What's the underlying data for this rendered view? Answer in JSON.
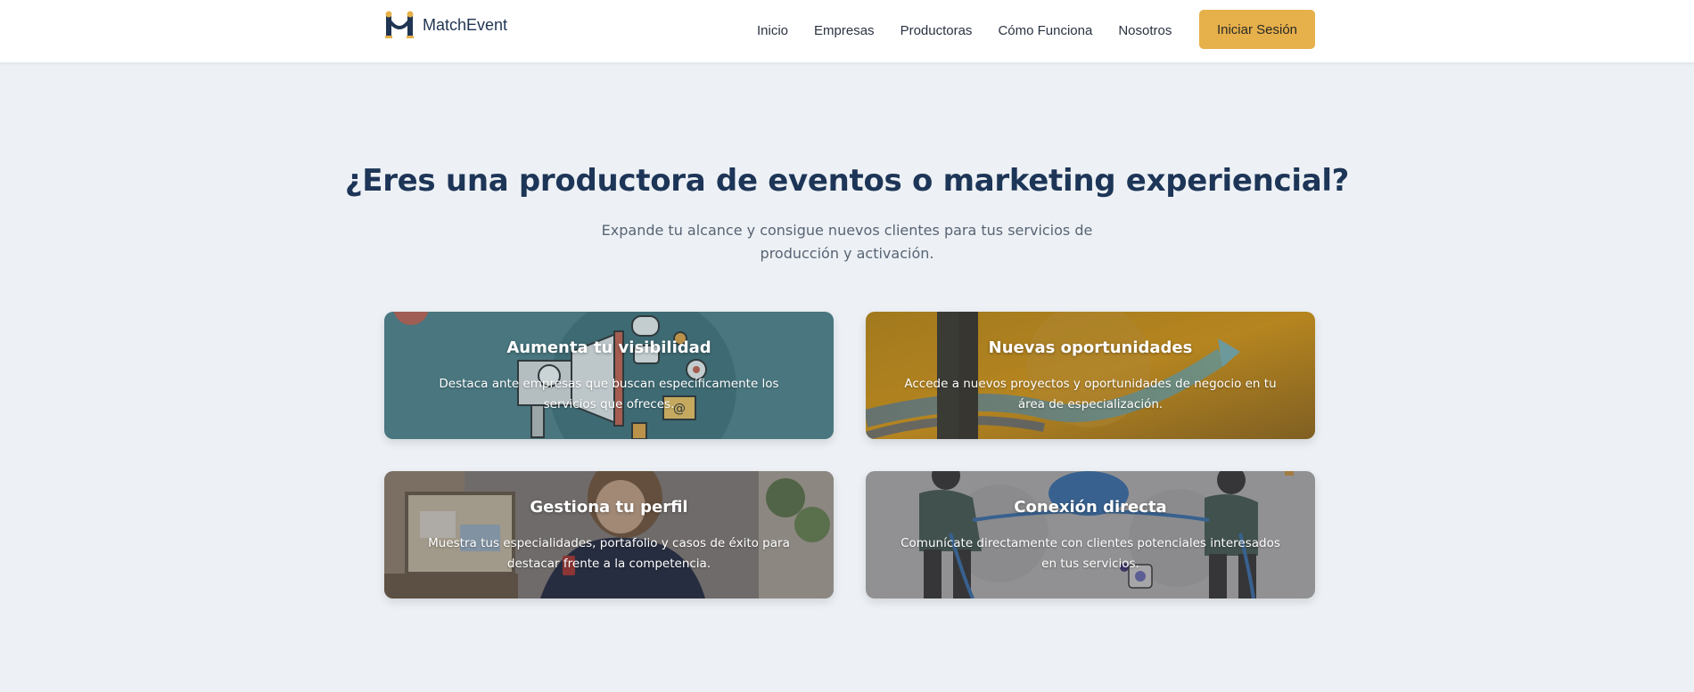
{
  "header": {
    "logo_text": "MatchEvent",
    "logo_icon": "match-event-logo-icon",
    "nav": [
      "Inicio",
      "Empresas",
      "Productoras",
      "Cómo Funciona",
      "Nosotros"
    ],
    "login_label": "Iniciar Sesión"
  },
  "hero": {
    "title": "¿Eres una productora de eventos o marketing experiencial?",
    "subtitle": "Expande tu alcance y consigue nuevos clientes para tus servicios de producción y activación."
  },
  "cards": [
    {
      "title": "Aumenta tu visibilidad",
      "description": "Destaca ante empresas que buscan específicamente los servicios que ofreces.",
      "image": "megaphone-illustration"
    },
    {
      "title": "Nuevas oportunidades",
      "description": "Accede a nuevos proyectos y oportunidades de negocio en tu área de especialización.",
      "image": "businessman-growth-arrow-photo"
    },
    {
      "title": "Gestiona tu perfil",
      "description": "Muestra tus especialidades, portafolio y casos de éxito para destacar frente a la competencia.",
      "image": "woman-with-phone-photo"
    },
    {
      "title": "Conexión directa",
      "description": "Comunícate directamente con clientes potenciales interesados en tus servicios.",
      "image": "tug-of-war-illustration"
    }
  ],
  "colors": {
    "accent": "#e6b04a",
    "heading": "#1d3557",
    "background": "#edf1f5"
  }
}
